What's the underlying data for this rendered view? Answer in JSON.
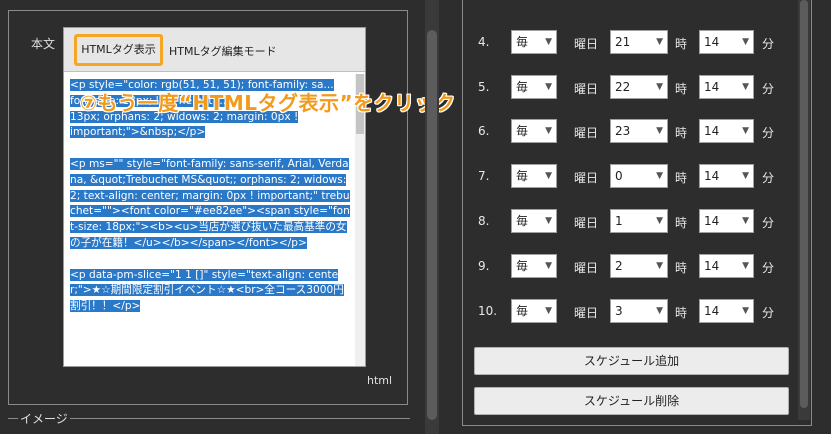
{
  "left": {
    "field_label": "本文",
    "tag_toggle_button": "HTMLタグ表示",
    "edit_mode_label": "HTMLタグ編集モード",
    "code_lines": [
      "<p style=\"color: rgb(51, 51, 51); font-family: sa...",
      "font-size: 13px; line-height:...",
      "13px; orphans: 2; widows: 2; margin: 0px !",
      "important;\">&nbsp;</p>"
    ],
    "code_block2": "<p ms=\"\" style=\"font-family: sans-serif, Arial, Verdana, &quot;Trebuchet MS&quot;; orphans: 2; widows: 2; text-align: center; margin: 0px ! important;\" trebuchet=\"\"><font color=\"#ee82ee\"><span style=\"font-size: 18px;\"><b><u>当店が選び抜いた最高基準の女の子が在籍！</u></b></span></font></p>",
    "code_block3": "<p data-pm-slice=\"1 1 []\" style=\"text-align: center;\">★☆期間限定割引イベント☆★<br>全コース3000円割引！！</p>",
    "html_label": "html",
    "image_legend": "イメージ"
  },
  "annotation": "⑦もう一度“HTMLタグ表示”をクリック",
  "schedule": {
    "rows": [
      {
        "num": "4.",
        "freq": "毎",
        "weekday_label": "曜日",
        "day": "21",
        "hour_label": "時",
        "hour": "14",
        "minute_label": "分"
      },
      {
        "num": "5.",
        "freq": "毎",
        "weekday_label": "曜日",
        "day": "22",
        "hour_label": "時",
        "hour": "14",
        "minute_label": "分"
      },
      {
        "num": "6.",
        "freq": "毎",
        "weekday_label": "曜日",
        "day": "23",
        "hour_label": "時",
        "hour": "14",
        "minute_label": "分"
      },
      {
        "num": "7.",
        "freq": "毎",
        "weekday_label": "曜日",
        "day": "0",
        "hour_label": "時",
        "hour": "14",
        "minute_label": "分"
      },
      {
        "num": "8.",
        "freq": "毎",
        "weekday_label": "曜日",
        "day": "1",
        "hour_label": "時",
        "hour": "14",
        "minute_label": "分"
      },
      {
        "num": "9.",
        "freq": "毎",
        "weekday_label": "曜日",
        "day": "2",
        "hour_label": "時",
        "hour": "14",
        "minute_label": "分"
      },
      {
        "num": "10.",
        "freq": "毎",
        "weekday_label": "曜日",
        "day": "3",
        "hour_label": "時",
        "hour": "14",
        "minute_label": "分"
      }
    ],
    "add_button": "スケジュール追加",
    "delete_button": "スケジュール削除"
  },
  "icons": {
    "dropdown": "chevron-down-icon"
  },
  "colors": {
    "accent": "#f39a1a",
    "selection": "#2a78c8",
    "background": "#2d2d2d"
  }
}
